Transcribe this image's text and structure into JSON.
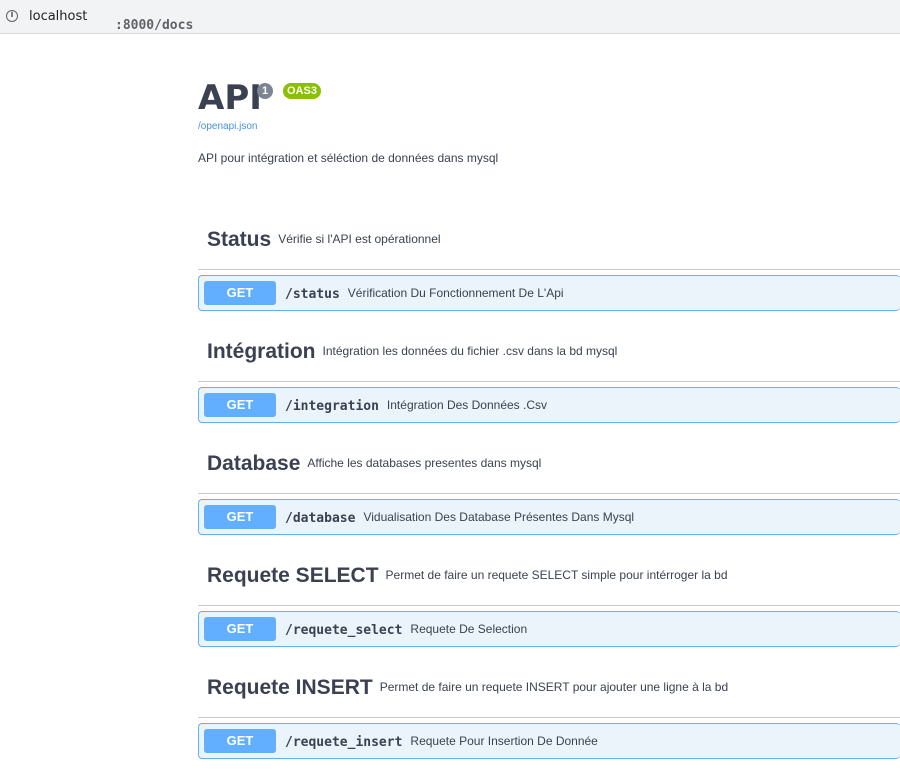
{
  "browser": {
    "url_host": "localhost",
    "url_path": ":8000/docs",
    "info_icon": "info-icon"
  },
  "api": {
    "title": "API",
    "version": "1",
    "oas_badge": "OAS3",
    "spec_link": "/openapi.json",
    "description": "API pour intégration et séléction de données dans mysql"
  },
  "colors": {
    "get_method": "#61affe",
    "get_block_bg": "#ebf3fb",
    "oas_badge": "#89bf04",
    "version_badge": "#7d8492",
    "link": "#4990e2"
  },
  "sections": [
    {
      "name": "Status",
      "description": "Vérifie si l'API est opérationnel",
      "method": "GET",
      "path": "/status",
      "summary": "Vérification Du Fonctionnement De L'Api"
    },
    {
      "name": "Intégration",
      "description": "Intégration les données du fichier .csv dans la bd mysql",
      "method": "GET",
      "path": "/integration",
      "summary": "Intégration Des Données .Csv"
    },
    {
      "name": "Database",
      "description": "Affiche les databases presentes dans mysql",
      "method": "GET",
      "path": "/database",
      "summary": "Vidualisation Des Database Présentes Dans Mysql"
    },
    {
      "name": "Requete SELECT",
      "description": "Permet de faire un requete SELECT simple pour intérroger la bd",
      "method": "GET",
      "path": "/requete_select",
      "summary": "Requete De Selection"
    },
    {
      "name": "Requete INSERT",
      "description": "Permet de faire un requete INSERT pour ajouter une ligne à la bd",
      "method": "GET",
      "path": "/requete_insert",
      "summary": "Requete Pour Insertion De Donnée"
    }
  ]
}
